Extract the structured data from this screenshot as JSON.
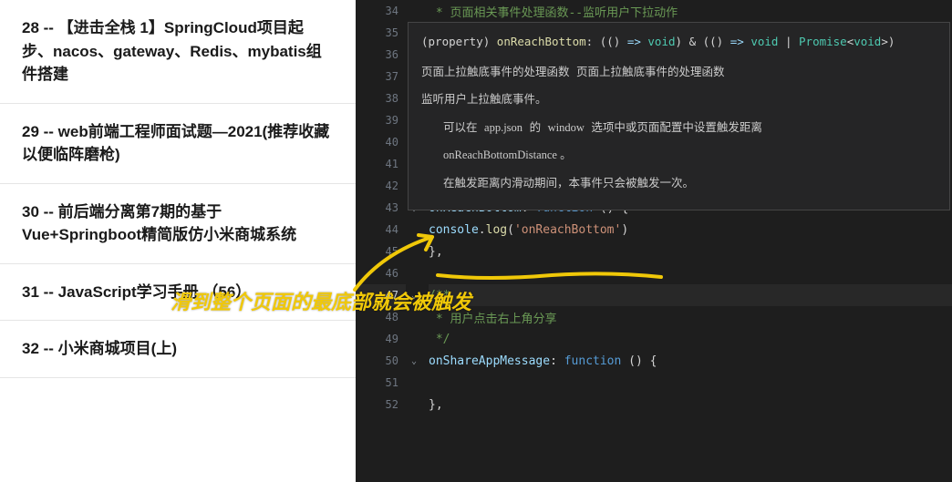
{
  "sidebar": {
    "items": [
      {
        "label": "28 --  【进击全栈 1】SpringCloud项目起步、nacos、gateway、Redis、mybatis组件搭建"
      },
      {
        "label": "29 -- web前端工程师面试题—2021(推荐收藏以便临阵磨枪)"
      },
      {
        "label": "30 -- 前后端分离第7期的基于Vue+Springboot精简版仿小米商城系统"
      },
      {
        "label": "31 -- JavaScript学习手册 （56）"
      },
      {
        "label": "32 -- 小米商城项目(上)"
      }
    ]
  },
  "editor": {
    "lines": [
      {
        "n": "34",
        "fold": false
      },
      {
        "n": "35",
        "fold": false
      },
      {
        "n": "36",
        "fold": true
      },
      {
        "n": "37",
        "fold": false
      },
      {
        "n": "38",
        "fold": false
      },
      {
        "n": "39",
        "fold": false
      },
      {
        "n": "40",
        "fold": true
      },
      {
        "n": "41",
        "fold": false
      },
      {
        "n": "42",
        "fold": false
      },
      {
        "n": "43",
        "fold": true
      },
      {
        "n": "44",
        "fold": false
      },
      {
        "n": "45",
        "fold": false
      },
      {
        "n": "46",
        "fold": false
      },
      {
        "n": "47",
        "fold": true,
        "active": true
      },
      {
        "n": "48",
        "fold": false
      },
      {
        "n": "49",
        "fold": false
      },
      {
        "n": "50",
        "fold": true
      },
      {
        "n": "51",
        "fold": false
      },
      {
        "n": "52",
        "fold": false
      }
    ],
    "code": {
      "l34": " * 页面相关事件处理函数--监听用户下拉动作",
      "l43_key": "onReachBottom",
      "l43_rest": ": ",
      "l43_kw": "function",
      "l43_paren": " () {",
      "l44_obj": "console",
      "l44_dot": ".",
      "l44_fn": "log",
      "l44_open": "(",
      "l44_str": "'onReachBottom'",
      "l44_close": ")",
      "l45": "},",
      "l47": "/**",
      "l48": " * 用户点击右上角分享",
      "l49": " */",
      "l50_key": "onShareAppMessage",
      "l50_rest": ": ",
      "l50_kw": "function",
      "l50_paren": " () {",
      "l52": "},"
    }
  },
  "tooltip": {
    "sig_prefix": "(property) ",
    "sig_name": "onReachBottom",
    "sig_type": ": (() => void) & (() => void | Promise<void>)",
    "desc1": "页面上拉触底事件的处理函数 页面上拉触底事件的处理函数",
    "desc2": "监听用户上拉触底事件。",
    "desc3_a": "可以在 ",
    "desc3_b": "app.json",
    "desc3_c": " 的 ",
    "desc3_d": "window",
    "desc3_e": " 选项中或页面配置中设置触发距离",
    "desc4": "onReachBottomDistance 。",
    "desc5": "在触发距离内滑动期间，本事件只会被触发一次。"
  },
  "annotation": "滑到整个页面的最底部就会被触发",
  "colors": {
    "annotation": "#f0c808",
    "editor_bg": "#1e1e1e"
  }
}
